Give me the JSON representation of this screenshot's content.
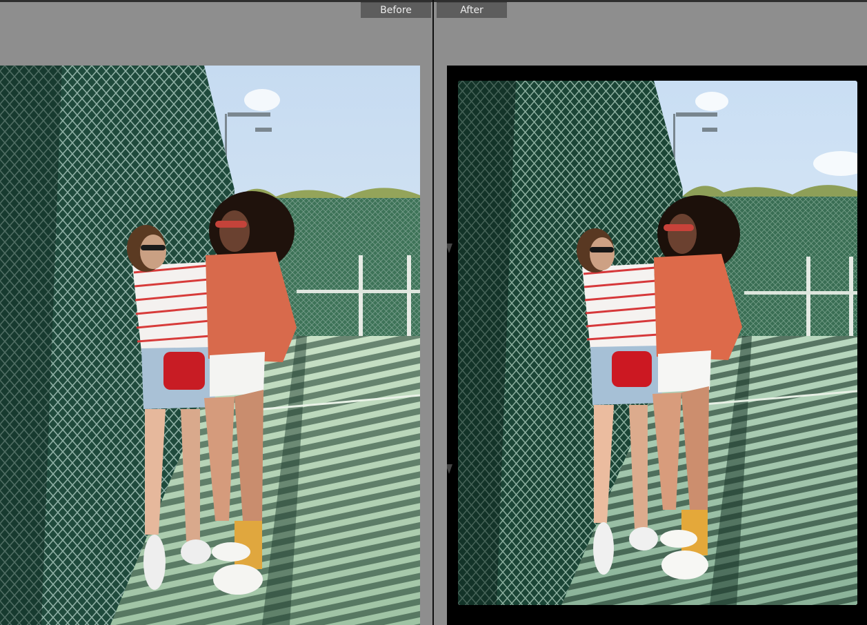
{
  "compare": {
    "before_label": "Before",
    "after_label": "After"
  },
  "colors": {
    "app_background": "#8e8e8e",
    "label_background": "#5d5d5d",
    "label_text": "#ececec",
    "divider": "#0e0e0e",
    "film_border": "#000000"
  },
  "images": {
    "before": "photo-before",
    "after": "photo-after-film-border"
  }
}
